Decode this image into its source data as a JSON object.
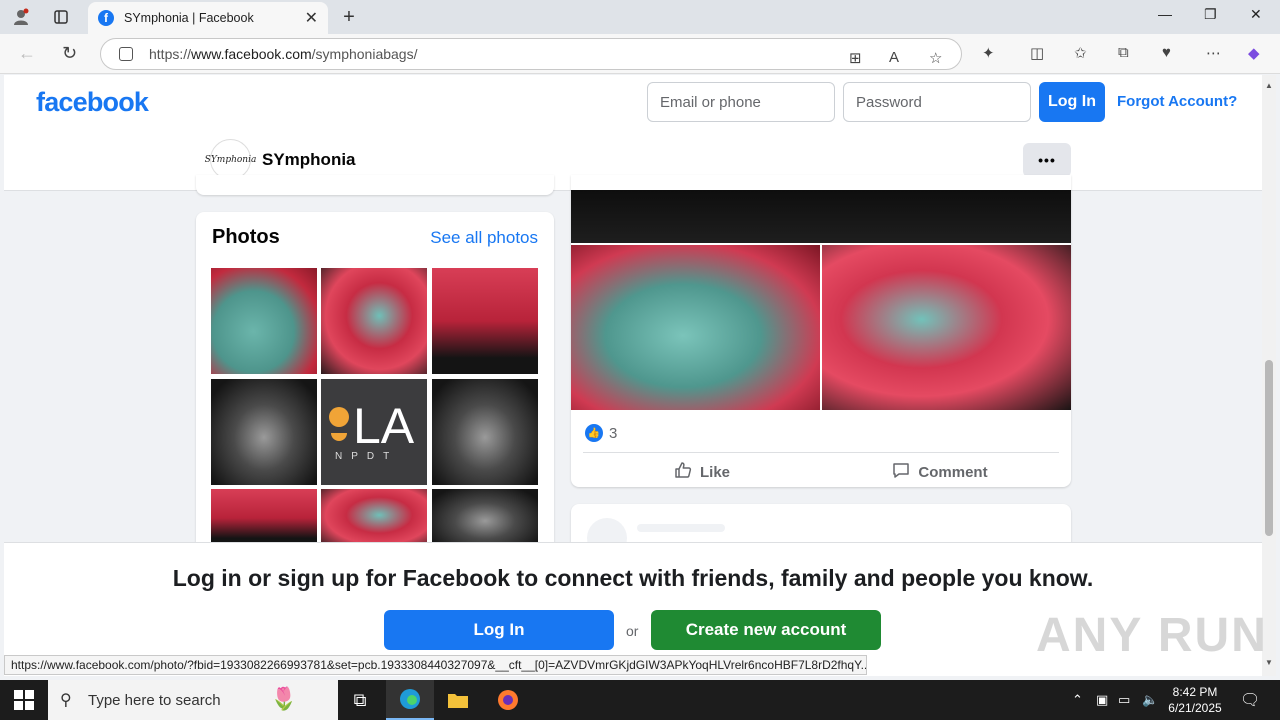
{
  "browser": {
    "tab_title": "SYmphonia | Facebook",
    "tab_favicon": "f",
    "new_tab": "+",
    "url_prefix": "https://",
    "url_host": "www.facebook.com",
    "url_path": "/symphoniabags/"
  },
  "header": {
    "logo": "facebook",
    "email_placeholder": "Email or phone",
    "password_placeholder": "Password",
    "login_label": "Log In",
    "forgot_label": "Forgot Account?"
  },
  "page": {
    "avatar_text": "SYmphonia",
    "name": "SYmphonia",
    "more_label": "•••"
  },
  "photos": {
    "title": "Photos",
    "see_all": "See all photos",
    "la_logo_text": "LA",
    "la_logo_sub": "NPDT"
  },
  "post": {
    "like_count": "3",
    "like_label": "Like",
    "comment_label": "Comment"
  },
  "login_banner": {
    "text": "Log in or sign up for Facebook to connect with friends, family and people you know.",
    "login_label": "Log In",
    "or_label": "or",
    "create_label": "Create new account"
  },
  "status_url": "https://www.facebook.com/photo/?fbid=1933082266993781&set=pcb.1933308440327097&__cft__[0]=AZVDVmrGKjdGIW3APkYoqHLVrelr6ncoHBF7L8rD2fhqY...",
  "watermark": "ANY RUN",
  "taskbar": {
    "search_placeholder": "Type here to search",
    "time": "8:42 PM",
    "date": "6/21/2025"
  },
  "colors": {
    "fb_blue": "#1877f2",
    "create_green": "#1f8a33"
  }
}
